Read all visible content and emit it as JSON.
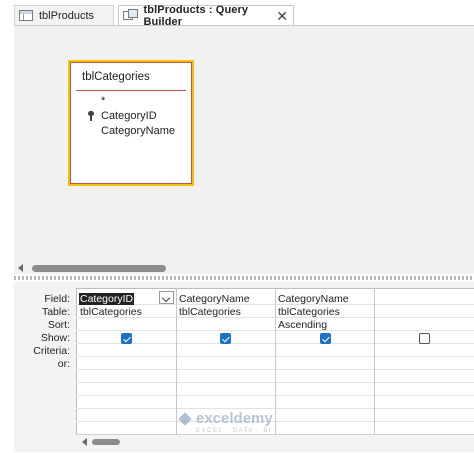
{
  "tabs": [
    {
      "label": "tblProducts",
      "active": false
    },
    {
      "label": "tblProducts : Query Builder",
      "active": true
    }
  ],
  "tab_close": "✕",
  "table_box": {
    "title": "tblCategories",
    "fields": [
      "*",
      "CategoryID",
      "CategoryName"
    ],
    "key_field": "CategoryID"
  },
  "grid": {
    "row_labels": {
      "field": "Field:",
      "table": "Table:",
      "sort": "Sort:",
      "show": "Show:",
      "criteria": "Criteria:",
      "or": "or:"
    },
    "columns": [
      {
        "field": "CategoryID",
        "table": "tblCategories",
        "sort": "",
        "show": true
      },
      {
        "field": "CategoryName",
        "table": "tblCategories",
        "sort": "",
        "show": true
      },
      {
        "field": "CategoryName",
        "table": "tblCategories",
        "sort": "Ascending",
        "show": true
      },
      {
        "field": "",
        "table": "",
        "sort": "",
        "show": false
      }
    ]
  },
  "watermark": {
    "name": "exceldemy",
    "tagline": "EXCEL · DATA · BI"
  },
  "colors": {
    "selected_table_border": "#f3c200",
    "table_inner_border": "#b9564f",
    "checkbox_on": "#1a73c8"
  }
}
